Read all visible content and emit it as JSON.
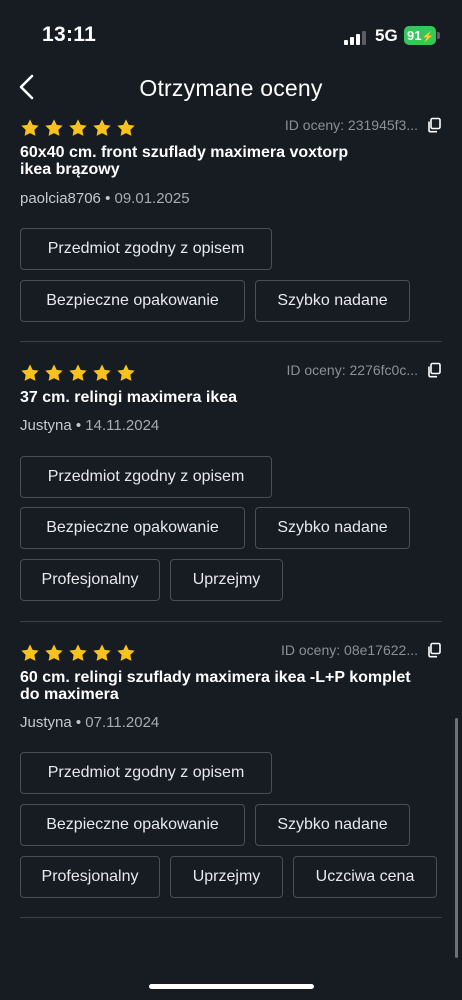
{
  "status": {
    "time": "13:11",
    "network": "5G",
    "battery": "91"
  },
  "nav": {
    "title": "Otrzymane oceny"
  },
  "reviews": [
    {
      "rating": 5,
      "id_label": "ID oceny: 231945f3...",
      "title": "60x40 cm. front szuflady maximera voxtorp ikea brązowy",
      "user": "paolcia8706",
      "date": "09.01.2025",
      "tags": [
        "Przedmiot zgodny z opisem",
        "Bezpieczne opakowanie",
        "Szybko nadane"
      ]
    },
    {
      "rating": 5,
      "id_label": "ID oceny: 2276fc0c...",
      "title": "37 cm. relingi maximera ikea",
      "user": "Justyna",
      "date": "14.11.2024",
      "tags": [
        "Przedmiot zgodny z opisem",
        "Bezpieczne opakowanie",
        "Szybko nadane",
        "Profesjonalny",
        "Uprzejmy"
      ]
    },
    {
      "rating": 5,
      "id_label": "ID oceny: 08e17622...",
      "title": "60 cm. relingi szuflady maximera  ikea -L+P komplet do maximera",
      "user": "Justyna",
      "date": "07.11.2024",
      "tags": [
        "Przedmiot zgodny z opisem",
        "Bezpieczne opakowanie",
        "Szybko nadane",
        "Profesjonalny",
        "Uprzejmy",
        "Uczciwa cena"
      ]
    }
  ],
  "icons": {
    "star": "star-icon",
    "copy": "copy-icon",
    "back": "chevron-left-icon"
  },
  "colors": {
    "background": "#171b22",
    "star": "#f7c21b",
    "battery": "#34c759"
  },
  "separator": " • "
}
